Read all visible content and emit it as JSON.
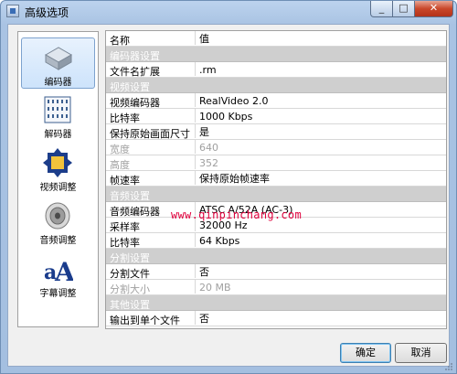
{
  "window": {
    "title": "高级选项"
  },
  "sidebar": {
    "items": [
      {
        "label": "编码器",
        "icon": "encoder-icon",
        "selected": true
      },
      {
        "label": "解码器",
        "icon": "decoder-icon",
        "selected": false
      },
      {
        "label": "视频调整",
        "icon": "video-adjust-icon",
        "selected": false
      },
      {
        "label": "音频调整",
        "icon": "audio-adjust-icon",
        "selected": false
      },
      {
        "label": "字幕调整",
        "icon": "subtitle-adjust-icon",
        "selected": false
      }
    ]
  },
  "grid": {
    "header": {
      "name": "名称",
      "value": "值"
    },
    "rows": [
      {
        "type": "section",
        "name": "编码器设置"
      },
      {
        "type": "item",
        "name": "文件名扩展",
        "value": ".rm"
      },
      {
        "type": "section",
        "name": "视频设置"
      },
      {
        "type": "item",
        "name": "视频编码器",
        "value": "RealVideo 2.0"
      },
      {
        "type": "item",
        "name": "比特率",
        "value": "1000 Kbps"
      },
      {
        "type": "item",
        "name": "保持原始画面尺寸",
        "value": "是"
      },
      {
        "type": "item",
        "name": "宽度",
        "value": "640",
        "disabled": true
      },
      {
        "type": "item",
        "name": "高度",
        "value": "352",
        "disabled": true
      },
      {
        "type": "item",
        "name": "帧速率",
        "value": "保持原始帧速率"
      },
      {
        "type": "section",
        "name": "音频设置"
      },
      {
        "type": "item",
        "name": "音频编码器",
        "value": "ATSC A/52A (AC-3)"
      },
      {
        "type": "item",
        "name": "采样率",
        "value": "32000 Hz"
      },
      {
        "type": "item",
        "name": "比特率",
        "value": "64 Kbps"
      },
      {
        "type": "section",
        "name": "分割设置"
      },
      {
        "type": "item",
        "name": "分割文件",
        "value": "否"
      },
      {
        "type": "item",
        "name": "分割大小",
        "value": "20 MB",
        "disabled": true
      },
      {
        "type": "section",
        "name": "其他设置"
      },
      {
        "type": "item",
        "name": "输出到单个文件",
        "value": "否"
      }
    ]
  },
  "watermark": "www.qinpinchang.com",
  "footer": {
    "ok_label": "确定",
    "cancel_label": "取消"
  },
  "colors": {
    "section_bg": "#cfcfcf",
    "disabled_text": "#a0a0a0",
    "watermark": "#e0003c",
    "selected_item_bg": "#cde3fb"
  }
}
